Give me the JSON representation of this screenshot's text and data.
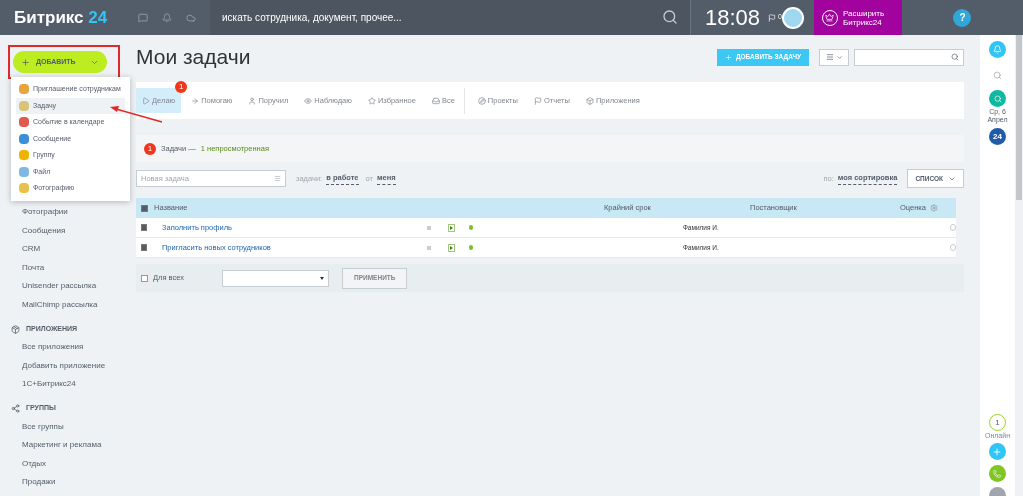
{
  "header": {
    "logo": "Битрикс",
    "logo_accent": "24",
    "search": {
      "placeholder": "искать сотрудника, документ, прочее..."
    },
    "time": "18:08",
    "flag_count": "0",
    "upgrade": "Расширить Битрикс24",
    "help": "?"
  },
  "add_button": {
    "label": "ДОБАВИТЬ"
  },
  "add_menu": [
    {
      "label": "Приглашение сотрудникам",
      "selected": false
    },
    {
      "label": "Задачу",
      "selected": true
    },
    {
      "label": "Событие в календаре",
      "selected": false
    },
    {
      "label": "Сообщение",
      "selected": false
    },
    {
      "label": "Группу",
      "selected": false
    },
    {
      "label": "Файл",
      "selected": false
    },
    {
      "label": "Фотографию",
      "selected": false
    }
  ],
  "sidebar": [
    {
      "kind": "item",
      "label": "Фотографии"
    },
    {
      "kind": "item",
      "label": "Сообщения"
    },
    {
      "kind": "item",
      "label": "CRM"
    },
    {
      "kind": "item",
      "label": "Почта"
    },
    {
      "kind": "item",
      "label": "Unisender рассылка"
    },
    {
      "kind": "item",
      "label": "MailChimp рассылка"
    },
    {
      "kind": "section",
      "label": "ПРИЛОЖЕНИЯ"
    },
    {
      "kind": "item",
      "label": "Все приложения"
    },
    {
      "kind": "item",
      "label": "Добавить приложение"
    },
    {
      "kind": "item",
      "label": "1С+Битрикс24"
    },
    {
      "kind": "section",
      "label": "ГРУППЫ"
    },
    {
      "kind": "item",
      "label": "Все группы"
    },
    {
      "kind": "item",
      "label": "Маркетинг и реклама"
    },
    {
      "kind": "item",
      "label": "Отдых"
    },
    {
      "kind": "item",
      "label": "Продажи"
    }
  ],
  "page_title": "Мои задачи",
  "add_task_button": "ДОБАВИТЬ ЗАДАЧУ",
  "tabs": [
    {
      "label": "Делаю",
      "selected": true,
      "badge": "1"
    },
    {
      "label": "Помогаю",
      "selected": false
    },
    {
      "label": "Поручил",
      "selected": false
    },
    {
      "label": "Наблюдаю",
      "selected": false
    },
    {
      "label": "Избранное",
      "selected": false
    },
    {
      "label": "Все",
      "selected": false
    },
    {
      "label": "Проекты",
      "selected": false
    },
    {
      "label": "Отчеты",
      "selected": false
    },
    {
      "label": "Приложения",
      "selected": false
    }
  ],
  "notice": {
    "count": "1",
    "text": "Задачи —",
    "link": "1 непросмотренная"
  },
  "filter": {
    "new_task": {
      "placeholder": "Новая задача"
    },
    "tasks_label": "задачи:",
    "status": "в работе",
    "from_label": "от",
    "from": "меня",
    "sort_label": "по:",
    "sort": "моя сортировка",
    "view": "СПИСОК"
  },
  "table": {
    "columns": [
      "Название",
      "Крайний срок",
      "Постановщик",
      "Оценка"
    ],
    "header_checked": true,
    "rows": [
      {
        "title": "Заполнить профиль",
        "checked": true,
        "creator": "Фамилия И."
      },
      {
        "title": "Пригласить новых сотрудников",
        "checked": true,
        "creator": "Фамилия И."
      }
    ]
  },
  "footer": {
    "for_all": "Для всех",
    "for_all_checked": false,
    "apply": "ПРИМЕНИТЬ"
  },
  "right_rail": {
    "date": "Ср, 6 Апрел",
    "badge": "24",
    "online_count": "1",
    "online_label": "Онлайн"
  }
}
